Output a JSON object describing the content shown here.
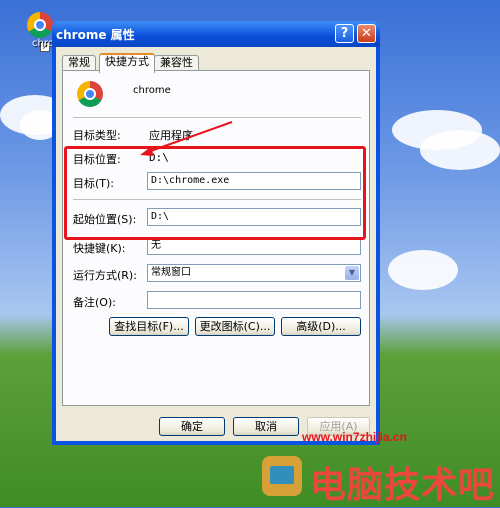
{
  "desktop": {
    "icon_label": "chrome"
  },
  "window": {
    "title": "chrome 属性",
    "help_glyph": "?",
    "close_glyph": "✕"
  },
  "tabs": [
    {
      "label": "常规",
      "active": false
    },
    {
      "label": "快捷方式",
      "active": true
    },
    {
      "label": "兼容性",
      "active": false
    }
  ],
  "shortcut": {
    "name": "chrome",
    "target_type_label": "目标类型:",
    "target_type_value": "应用程序",
    "target_location_label": "目标位置:",
    "target_location_value": "D:\\",
    "target_label": "目标(T):",
    "target_value": "D:\\chrome.exe",
    "start_in_label": "起始位置(S):",
    "start_in_value": "D:\\",
    "hotkey_label": "快捷键(K):",
    "hotkey_value": "无",
    "run_label": "运行方式(R):",
    "run_value": "常规窗口",
    "comment_label": "备注(O):",
    "comment_value": ""
  },
  "buttons": {
    "find_target": "查找目标(F)...",
    "change_icon": "更改图标(C)...",
    "advanced": "高级(D)...",
    "ok": "确定",
    "cancel": "取消",
    "apply": "应用(A)"
  },
  "watermark": {
    "url": "www.win7zhijia.cn",
    "brand": "电脑技术吧"
  },
  "colors": {
    "highlight": "#e8141d",
    "xp_titlebar": "#0a54e3",
    "dialog_bg": "#ece9d8"
  }
}
